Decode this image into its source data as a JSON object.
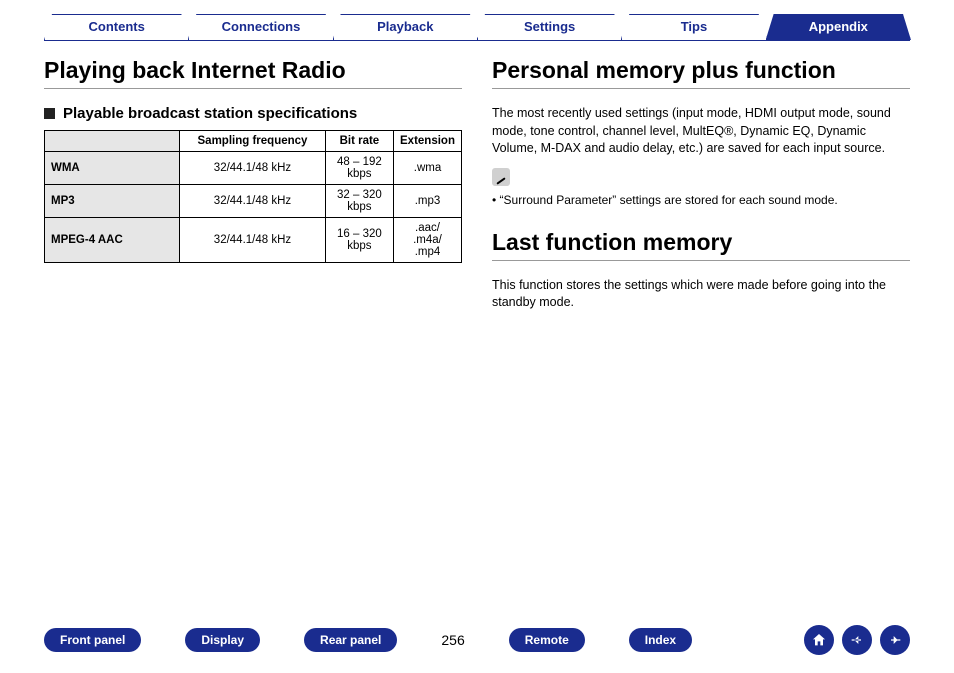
{
  "tabs": [
    "Contents",
    "Connections",
    "Playback",
    "Settings",
    "Tips",
    "Appendix"
  ],
  "activeTab": 5,
  "left": {
    "heading": "Playing back Internet Radio",
    "subheading": "Playable broadcast station specifications",
    "table": {
      "headers": [
        "Sampling frequency",
        "Bit rate",
        "Extension"
      ],
      "rows": [
        {
          "name": "WMA",
          "samp": "32/44.1/48 kHz",
          "bit": "48 – 192 kbps",
          "ext": ".wma"
        },
        {
          "name": "MP3",
          "samp": "32/44.1/48 kHz",
          "bit": "32 – 320 kbps",
          "ext": ".mp3"
        },
        {
          "name": "MPEG-4 AAC",
          "samp": "32/44.1/48 kHz",
          "bit": "16 – 320 kbps",
          "ext": ".aac/ .m4a/ .mp4"
        }
      ]
    }
  },
  "right": {
    "heading1": "Personal memory plus function",
    "para1": "The most recently used settings (input mode, HDMI output mode, sound mode, tone control, channel level, MultEQ®, Dynamic EQ, Dynamic Volume, M-DAX and audio delay, etc.) are saved for each input source.",
    "note": "“Surround Parameter” settings are stored for each sound mode.",
    "heading2": "Last function memory",
    "para2": "This function stores the settings which were made before going into the standby mode."
  },
  "bottom": {
    "buttons": [
      "Front panel",
      "Display",
      "Rear panel"
    ],
    "page": "256",
    "buttons2": [
      "Remote",
      "Index"
    ]
  }
}
